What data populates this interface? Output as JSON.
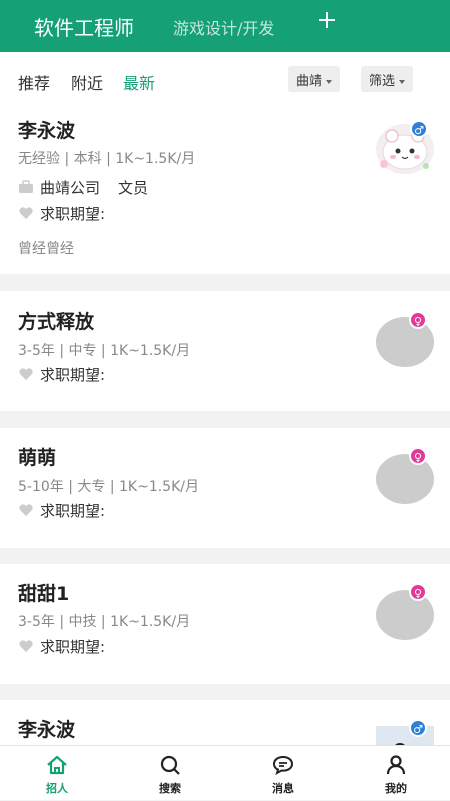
{
  "header": {
    "tab_main": "软件工程师",
    "tab_second": "游戏设计/开发",
    "add_icon": "plus-icon",
    "bg_color": "#16a076"
  },
  "filters": {
    "tabs": [
      "推荐",
      "附近",
      "最新"
    ],
    "active_tab": "最新",
    "city": "曲靖",
    "filter": "筛选"
  },
  "candidates": [
    {
      "name": "李永波",
      "meta": "无经验 | 本科 | 1K~1.5K/月",
      "company": "曲靖公司",
      "position": "文员",
      "expectation": "求职期望:",
      "note": "曾经曾经",
      "gender": "male"
    },
    {
      "name": "方式释放",
      "meta": "3-5年 | 中专 | 1K~1.5K/月",
      "expectation": "求职期望:",
      "gender": "female"
    },
    {
      "name": "萌萌",
      "meta": "5-10年 | 大专 | 1K~1.5K/月",
      "expectation": "求职期望:",
      "gender": "female"
    },
    {
      "name": "甜甜1",
      "meta": "3-5年 | 中技 | 1K~1.5K/月",
      "expectation": "求职期望:",
      "gender": "female"
    },
    {
      "name": "李永波",
      "gender": "male"
    }
  ],
  "tabbar": {
    "items": [
      {
        "label": "招人",
        "icon": "home-icon"
      },
      {
        "label": "搜索",
        "icon": "search-icon"
      },
      {
        "label": "消息",
        "icon": "message-icon"
      },
      {
        "label": "我的",
        "icon": "profile-icon"
      }
    ],
    "active": "招人",
    "accent": "#16a076"
  }
}
